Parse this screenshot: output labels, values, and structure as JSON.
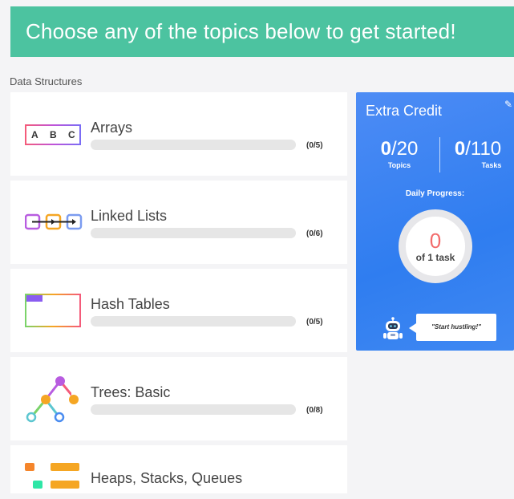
{
  "banner": {
    "text": "Choose any of the topics below to get started!"
  },
  "section": {
    "label": "Data Structures"
  },
  "topics": [
    {
      "title": "Arrays",
      "count": "(0/5)",
      "progress": 0,
      "icon": "abc-blocks-icon",
      "letters": [
        "A",
        "B",
        "C"
      ]
    },
    {
      "title": "Linked Lists",
      "count": "(0/6)",
      "progress": 0,
      "icon": "linked-nodes-icon"
    },
    {
      "title": "Hash Tables",
      "count": "(0/5)",
      "progress": 0,
      "icon": "table-grid-icon"
    },
    {
      "title": "Trees: Basic",
      "count": "(0/8)",
      "progress": 0,
      "icon": "tree-nodes-icon"
    },
    {
      "title": "Heaps, Stacks, Queues",
      "count": "",
      "progress": 0,
      "icon": "stacked-blocks-icon"
    }
  ],
  "extra_credit": {
    "title": "Extra Credit",
    "topics_done": "0",
    "topics_total": "/20",
    "topics_label": "Topics",
    "tasks_done": "0",
    "tasks_total": "/110",
    "tasks_label": "Tasks",
    "daily_label": "Daily Progress:",
    "daily_done": "0",
    "daily_target": "of 1 task",
    "bubble": "\"Start hustling!\""
  },
  "colors": {
    "banner": "#4cc3a0",
    "card_blue": "#3f86f3",
    "ring_number": "#f26b6b"
  }
}
